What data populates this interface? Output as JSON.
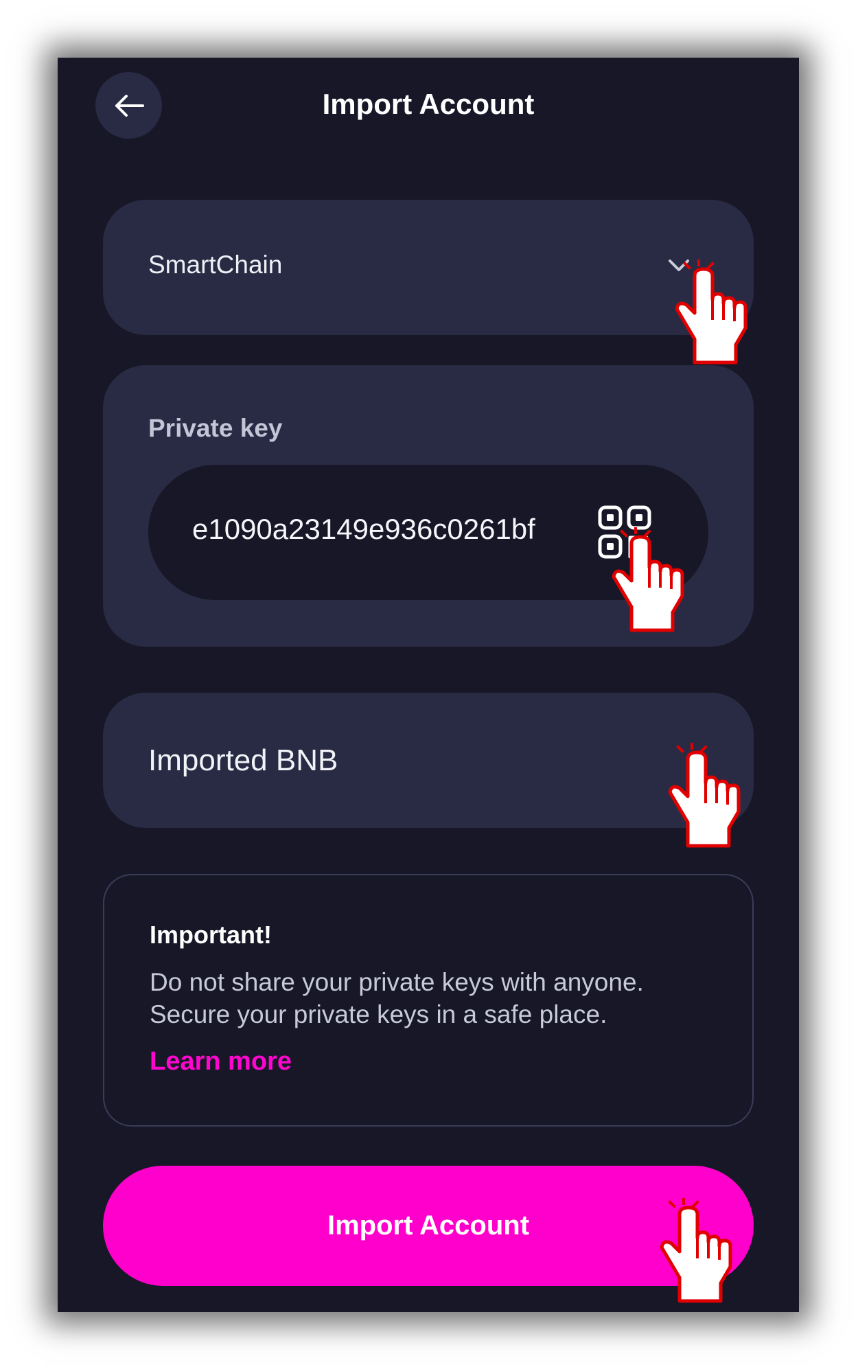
{
  "header": {
    "title": "Import Account",
    "back_icon": "arrow-left-icon"
  },
  "network_select": {
    "value": "SmartChain",
    "icon": "chevron-down-icon"
  },
  "private_key": {
    "label": "Private key",
    "value": "e1090a23149e936c0261bf",
    "scan_icon": "qr-scan-icon"
  },
  "account_name": {
    "value": "Imported BNB"
  },
  "notice": {
    "title": "Important!",
    "line1": "Do not share your private keys with anyone.",
    "line2": "Secure your private keys in a safe place.",
    "link_label": "Learn more"
  },
  "actions": {
    "import_label": "Import Account"
  },
  "colors": {
    "background": "#171727",
    "card": "#292b44",
    "accent": "#ff00cc",
    "pointer_outline": "#e00000"
  }
}
